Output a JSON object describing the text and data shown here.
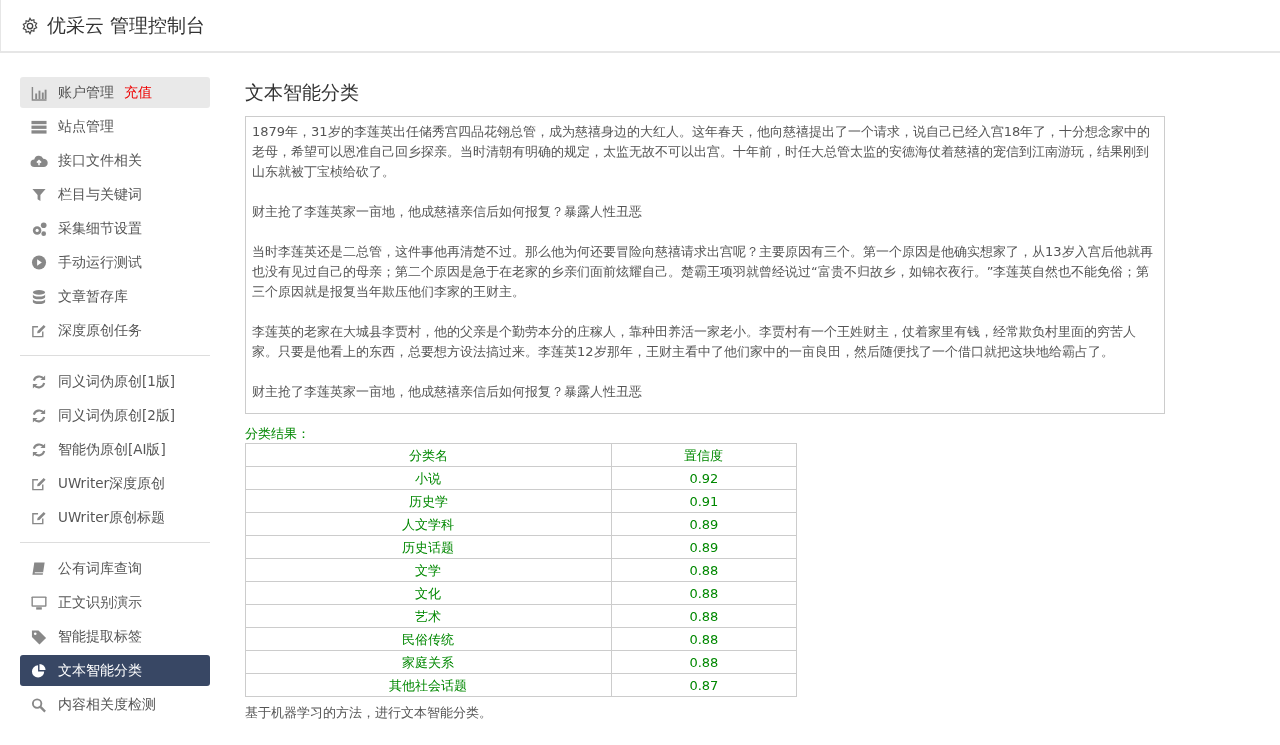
{
  "header": {
    "title": "优采云 管理控制台"
  },
  "sidebar": {
    "groups": [
      {
        "items": [
          {
            "label": "账户管理",
            "extra": "充值",
            "selected": false,
            "hovered": true
          },
          {
            "label": "站点管理",
            "selected": false,
            "hovered": false
          },
          {
            "label": "接口文件相关",
            "selected": false,
            "hovered": false
          },
          {
            "label": "栏目与关键词",
            "selected": false,
            "hovered": false
          },
          {
            "label": "采集细节设置",
            "selected": false,
            "hovered": false
          },
          {
            "label": "手动运行测试",
            "selected": false,
            "hovered": false
          },
          {
            "label": "文章暂存库",
            "selected": false,
            "hovered": false
          },
          {
            "label": "深度原创任务",
            "selected": false,
            "hovered": false
          }
        ]
      },
      {
        "items": [
          {
            "label": "同义词伪原创[1版]",
            "selected": false,
            "hovered": false
          },
          {
            "label": "同义词伪原创[2版]",
            "selected": false,
            "hovered": false
          },
          {
            "label": "智能伪原创[AI版]",
            "selected": false,
            "hovered": false
          },
          {
            "label": "UWriter深度原创",
            "selected": false,
            "hovered": false
          },
          {
            "label": "UWriter原创标题",
            "selected": false,
            "hovered": false
          }
        ]
      },
      {
        "items": [
          {
            "label": "公有词库查询",
            "selected": false,
            "hovered": false
          },
          {
            "label": "正文识别演示",
            "selected": false,
            "hovered": false
          },
          {
            "label": "智能提取标签",
            "selected": false,
            "hovered": false
          },
          {
            "label": "文本智能分类",
            "selected": true
          },
          {
            "label": "内容相关度检测",
            "selected": false,
            "hovered": false
          }
        ]
      }
    ]
  },
  "main": {
    "title": "文本智能分类",
    "text_input": {
      "paragraphs": [
        "1879年，31岁的李莲英出任储秀宫四品花翎总管，成为慈禧身边的大红人。这年春天，他向慈禧提出了一个请求，说自己已经入宫18年了，十分想念家中的老母，希望可以恩准自己回乡探亲。当时清朝有明确的规定，太监无故不可以出宫。十年前，时任大总管太监的安德海仗着慈禧的宠信到江南游玩，结果刚到山东就被丁宝桢给砍了。",
        "财主抢了李莲英家一亩地，他成慈禧亲信后如何报复？暴露人性丑恶",
        "当时李莲英还是二总管，这件事他再清楚不过。那么他为何还要冒险向慈禧请求出宫呢？主要原因有三个。第一个原因是他确实想家了，从13岁入宫后他就再也没有见过自己的母亲；第二个原因是急于在老家的乡亲们面前炫耀自己。楚霸王项羽就曾经说过“富贵不归故乡，如锦衣夜行。”李莲英自然也不能免俗；第三个原因就是报复当年欺压他们李家的王财主。",
        "李莲英的老家在大城县李贾村，他的父亲是个勤劳本分的庄稼人，靠种田养活一家老小。李贾村有一个王姓财主，仗着家里有钱，经常欺负村里面的穷苦人家。只要是他看上的东西，总要想方设法搞过来。李莲英12岁那年，王财主看中了他们家中的一亩良田，然后随便找了一个借口就把这块地给霸占了。",
        "财主抢了李莲英家一亩地，他成慈禧亲信后如何报复？暴露人性丑恶"
      ]
    },
    "result_label": "分类结果：",
    "table": {
      "columns": [
        "分类名",
        "置信度"
      ],
      "rows": [
        [
          "小说",
          "0.92"
        ],
        [
          "历史学",
          "0.91"
        ],
        [
          "人文学科",
          "0.89"
        ],
        [
          "历史话题",
          "0.89"
        ],
        [
          "文学",
          "0.88"
        ],
        [
          "文化",
          "0.88"
        ],
        [
          "艺术",
          "0.88"
        ],
        [
          "民俗传统",
          "0.88"
        ],
        [
          "家庭关系",
          "0.88"
        ],
        [
          "其他社会话题",
          "0.87"
        ]
      ]
    },
    "note": "基于机器学习的方法，进行文本智能分类。"
  }
}
